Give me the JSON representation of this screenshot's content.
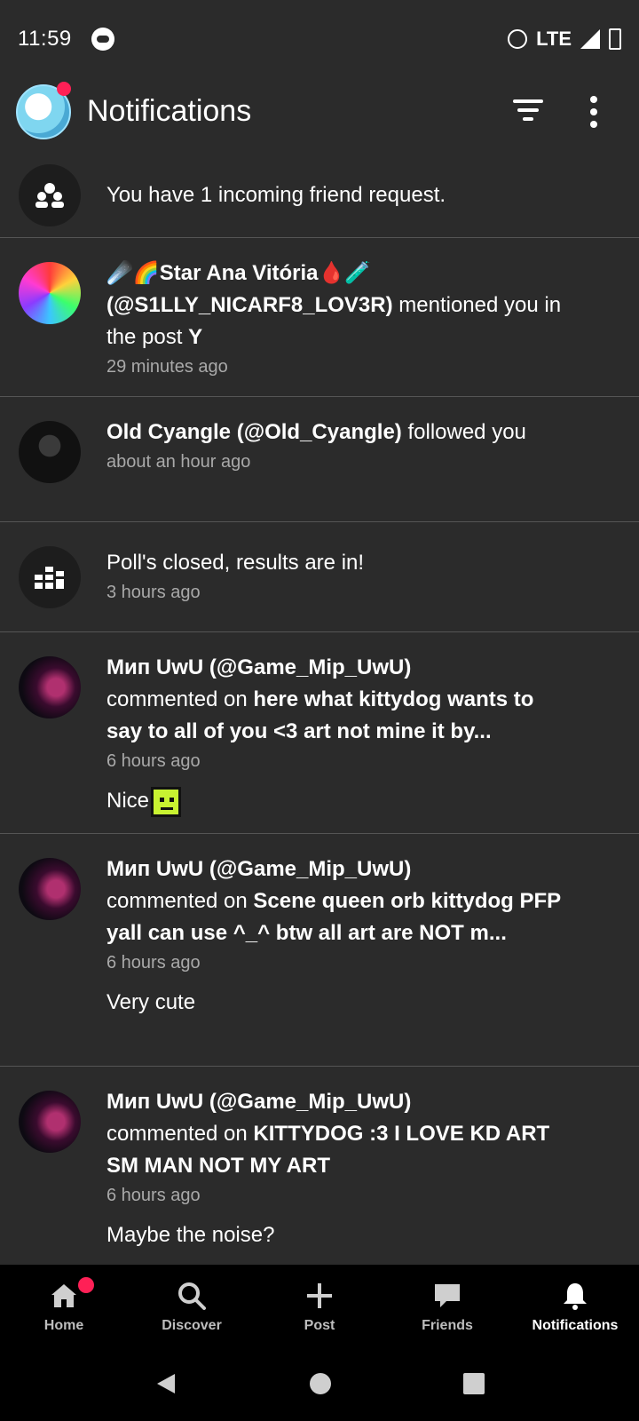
{
  "status_bar": {
    "time": "11:59",
    "network": "LTE",
    "icons": [
      "gamepad-icon",
      "alarm-icon",
      "signal-icon",
      "battery-icon"
    ]
  },
  "header": {
    "title": "Notifications",
    "icons": [
      "profile-avatar",
      "filter-icon",
      "more-options-icon"
    ]
  },
  "notifications": [
    {
      "type": "friend_request",
      "icon": "friends-icon",
      "text": "You have 1 incoming friend request."
    },
    {
      "type": "mention",
      "user_display": "☄️🌈Star Ana Vitória🩸🧪",
      "user_handle": "(@S1LLY_NICARF8_LOV3R)",
      "action": " mentioned you in the post ",
      "target": "Y",
      "time": "29 minutes ago"
    },
    {
      "type": "follow",
      "user_display": "Old Cyangle (@Old_Cyangle)",
      "action": " followed you",
      "time": "about an hour ago"
    },
    {
      "type": "poll",
      "icon": "poll-icon",
      "text": "Poll's closed, results are in!",
      "time": "3 hours ago"
    },
    {
      "type": "comment",
      "user_display": "Мип UwU (@Game_Mip_UwU)",
      "action": "commented on ",
      "target": "here what kittydog wants to say to all of you <3 art not mine it by...",
      "time": "6 hours ago",
      "comment": "Nice"
    },
    {
      "type": "comment",
      "user_display": "Мип UwU (@Game_Mip_UwU)",
      "action": "commented on ",
      "target": "Scene queen orb kittydog PFP yall can use ^_^ btw all art are NOT m...",
      "time": "6 hours ago",
      "comment": "Very cute"
    },
    {
      "type": "comment",
      "user_display": "Мип UwU (@Game_Mip_UwU)",
      "action": "commented on ",
      "target": "KITTYDOG :3 I LOVE KD ART SM MAN  NOT MY ART",
      "time": "6 hours ago",
      "comment": "Maybe the noise?"
    }
  ],
  "bottom_nav": [
    {
      "label": "Home",
      "icon": "home-icon"
    },
    {
      "label": "Discover",
      "icon": "search-icon"
    },
    {
      "label": "Post",
      "icon": "plus-icon"
    },
    {
      "label": "Friends",
      "icon": "chat-bubble-icon"
    },
    {
      "label": "Notifications",
      "icon": "bell-icon",
      "active": true
    }
  ],
  "colors": {
    "background": "#2b2b2b",
    "divider": "#555555",
    "badge": "#ff2056",
    "secondary_text": "#a9a9a9",
    "nav_background": "#000000"
  }
}
